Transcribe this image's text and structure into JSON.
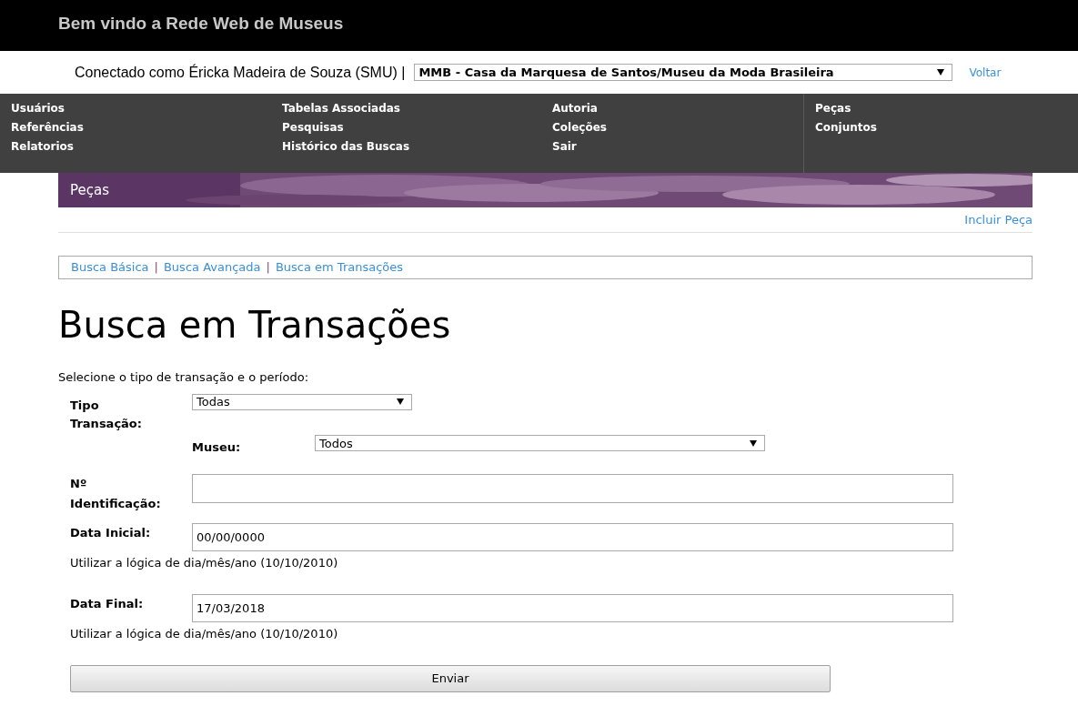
{
  "header": {
    "title": "Bem vindo a Rede Web de Museus"
  },
  "session": {
    "connected_as": "Conectado como Éricka Madeira de Souza (SMU) |",
    "museum_select": "MMB - Casa da Marquesa de Santos/Museu da Moda Brasileira",
    "back_link": "Voltar"
  },
  "nav_menu": {
    "columns": [
      [
        "Usuários",
        "Referências",
        "Relatorios"
      ],
      [
        "Tabelas Associadas",
        "Pesquisas",
        "Histórico das Buscas"
      ],
      [
        "Autoria",
        "Coleções",
        "Sair"
      ],
      [
        "Peças",
        "Conjuntos"
      ]
    ]
  },
  "section": {
    "title": "Peças",
    "action_link": "Incluir Peça"
  },
  "search_links": [
    {
      "label": "Busca Básica"
    },
    {
      "label": "Busca Avançada"
    },
    {
      "label": "Busca em Transações"
    }
  ],
  "separators": [
    "|",
    "|"
  ],
  "page_title": "Busca em Transações",
  "instructions": "Selecione o tipo de transação e o período:",
  "form": {
    "transaction_type": {
      "label": "Tipo Transação:",
      "value": "Todas"
    },
    "museum": {
      "label": "Museu:",
      "value": "Todos"
    },
    "identification": {
      "label": "Nº Identificação:"
    },
    "start_date": {
      "label": "Data Inicial:",
      "value": "00/00/0000",
      "hint": "Utilizar a lógica de dia/mês/ano (10/10/2010)"
    },
    "end_date": {
      "label": "Data Final:",
      "value": "17/03/2018",
      "hint": "Utilizar a lógica de dia/mês/ano (10/10/2010)"
    },
    "submit": "Enviar"
  }
}
